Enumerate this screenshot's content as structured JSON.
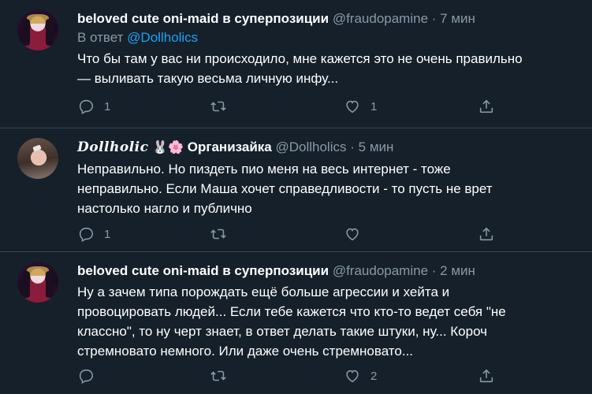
{
  "colors": {
    "background": "#15202b",
    "text": "#ffffff",
    "muted": "#8899a6",
    "link": "#1da1f2",
    "divider": "#38444d"
  },
  "tweets": [
    {
      "display_name": "beloved cute oni-maid в суперпозиции",
      "handle": "@fraudopamine",
      "dot": "·",
      "time": "7 мин",
      "reply_prefix": "В ответ ",
      "reply_mention": "@Dollholics",
      "text": "Что бы там у вас ни происходило, мне кажется это не очень правильно\n— выливать такую весьма личную инфу...",
      "reply_count": "1",
      "retweet_count": "",
      "like_count": "1",
      "share_count": ""
    },
    {
      "display_name_script": "Dollholic",
      "display_name_emoji": "🐰🌸",
      "display_name": "Организайка",
      "handle": "@Dollholics",
      "dot": "·",
      "time": "5 мин",
      "text": "Неправильно. Но пиздеть пио меня на весь интернет - тоже\nнеправильно. Если Маша хочет справедливости - то пусть не врет\nнастолько нагло и публично",
      "reply_count": "1",
      "retweet_count": "",
      "like_count": "",
      "share_count": ""
    },
    {
      "display_name": "beloved cute oni-maid в суперпозиции",
      "handle": "@fraudopamine",
      "dot": "·",
      "time": "2 мин",
      "text": "Ну а зачем типа порождать ещё больше агрессии и хейта и\nпровоцировать людей... Если тебе кажется что кто-то ведет себя \"не\nклассно\", то ну черт знает, в ответ делать такие штуки, ну... Короч\nстремновато немного. Или даже очень стремновато...",
      "reply_count": "",
      "retweet_count": "",
      "like_count": "2",
      "share_count": ""
    }
  ]
}
